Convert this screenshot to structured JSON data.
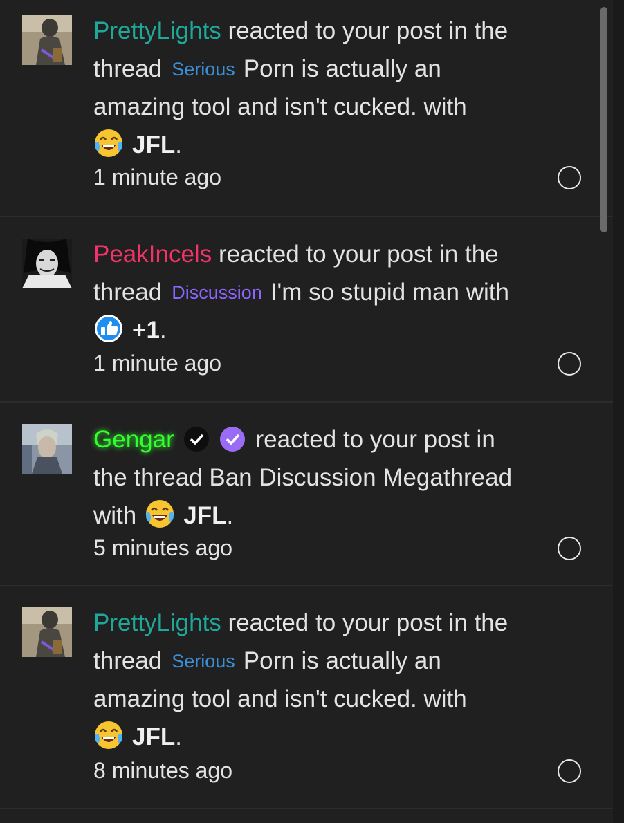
{
  "colors": {
    "background": "#202020",
    "prettylights": "#1fa89a",
    "peakincels": "#f0336b",
    "gengar": "#33ff2e",
    "serious_tag": "#3b8ed8",
    "discussion_tag": "#8b66ff"
  },
  "notifications": [
    {
      "username": "PrettyLights",
      "line1_rest": " reacted to your post in the",
      "line2_prefix": "thread",
      "tag": "Serious",
      "line2_rest": "Porn is actually an",
      "line3": "amazing tool and isn't cucked. with",
      "reaction_icon": "laughing-crying-emoji-icon",
      "reaction": "JFL",
      "time": "1 minute ago"
    },
    {
      "username": "PeakIncels",
      "line1_rest": " reacted to your post in the",
      "line2_prefix": "thread",
      "tag": "Discussion",
      "line2_rest": "I'm so stupid man with",
      "reaction_icon": "thumbs-up-icon",
      "reaction": "+1",
      "time": "1 minute ago"
    },
    {
      "username": "Gengar",
      "line1_rest": " reacted to your post in",
      "line2": "the thread Ban Discussion Megathread",
      "line3_prefix": "with",
      "reaction_icon": "laughing-crying-emoji-icon",
      "reaction": "JFL",
      "time": "5 minutes ago"
    },
    {
      "username": "PrettyLights",
      "line1_rest": " reacted to your post in the",
      "line2_prefix": "thread",
      "tag": "Serious",
      "line2_rest": "Porn is actually an",
      "line3": "amazing tool and isn't cucked. with",
      "reaction_icon": "laughing-crying-emoji-icon",
      "reaction": "JFL",
      "time": "8 minutes ago"
    }
  ]
}
